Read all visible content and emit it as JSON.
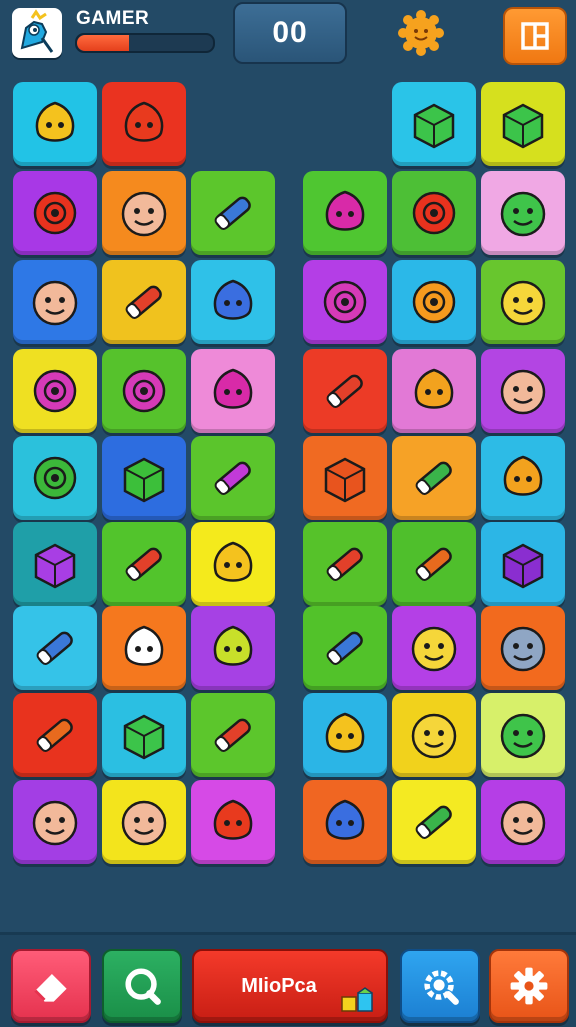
{
  "header": {
    "player_name": "GAMER",
    "health_percent": 38,
    "score": "00"
  },
  "footer": {
    "center_button_label": "MIioPca"
  },
  "board": {
    "tiles": [
      {
        "color": "#22c3e6",
        "icon": "shield-icon"
      },
      {
        "color": "#ea3320",
        "icon": "fire-creature-icon"
      },
      {
        "color": "#2ac4e8",
        "icon": "trash-can-icon"
      },
      {
        "color": "#d6e01e",
        "icon": "robot-icon"
      },
      {
        "color": "#a838e6",
        "icon": "gear-badge-icon"
      },
      {
        "color": "#f58a1e",
        "icon": "clown-icon"
      },
      {
        "color": "#5cc62c",
        "icon": "marker-icon"
      },
      {
        "color": "#4fc631",
        "icon": "berry-icon"
      },
      {
        "color": "#4dbf36",
        "icon": "no-sign-icon"
      },
      {
        "color": "#f0a8e4",
        "icon": "alien-blob-icon"
      },
      {
        "color": "#2e78e6",
        "icon": "blob-face-icon"
      },
      {
        "color": "#f0c21e",
        "icon": "crayon-icon"
      },
      {
        "color": "#2fc1e8",
        "icon": "cell-icon"
      },
      {
        "color": "#b43ee6",
        "icon": "ring-icon"
      },
      {
        "color": "#2bb8e8",
        "icon": "sun-icon"
      },
      {
        "color": "#68c62e",
        "icon": "smiley-icon"
      },
      {
        "color": "#efe022",
        "icon": "spiral-icon"
      },
      {
        "color": "#56c22c",
        "icon": "bubbles-icon"
      },
      {
        "color": "#ee8ad8",
        "icon": "badge-icon"
      },
      {
        "color": "#ec3b26",
        "icon": "torch-icon"
      },
      {
        "color": "#e279d6",
        "icon": "leaf-icon"
      },
      {
        "color": "#b345e3",
        "icon": "girl-face-icon"
      },
      {
        "color": "#2bc1dc",
        "icon": "virus-icon"
      },
      {
        "color": "#2d6de0",
        "icon": "tent-icon"
      },
      {
        "color": "#5bc52c",
        "icon": "eraser-icon"
      },
      {
        "color": "#f06a22",
        "icon": "bag-icon"
      },
      {
        "color": "#f6a226",
        "icon": "glue-stick-icon"
      },
      {
        "color": "#2dbbe6",
        "icon": "dragon-icon"
      },
      {
        "color": "#1f9fa8",
        "icon": "gem-block-icon"
      },
      {
        "color": "#52c42c",
        "icon": "pill-icon"
      },
      {
        "color": "#f4ea1c",
        "icon": "egg-icon"
      },
      {
        "color": "#56c22a",
        "icon": "capsule-icon"
      },
      {
        "color": "#4fbf2c",
        "icon": "wrench-icon"
      },
      {
        "color": "#2cb6e6",
        "icon": "canister-icon"
      },
      {
        "color": "#35c3e8",
        "icon": "pen-icon"
      },
      {
        "color": "#f5781e",
        "icon": "ghost-icon"
      },
      {
        "color": "#a641e4",
        "icon": "rocket-icon"
      },
      {
        "color": "#52c22a",
        "icon": "battery-icon"
      },
      {
        "color": "#b440e6",
        "icon": "cookie-icon"
      },
      {
        "color": "#f26a1e",
        "icon": "moon-icon"
      },
      {
        "color": "#e8331e",
        "icon": "feather-icon"
      },
      {
        "color": "#2bbfe2",
        "icon": "cube-icon"
      },
      {
        "color": "#5cc62c",
        "icon": "chalk-icon"
      },
      {
        "color": "#2bb5e6",
        "icon": "egg-red-icon"
      },
      {
        "color": "#f1d21c",
        "icon": "clock-face-icon"
      },
      {
        "color": "#d7f06a",
        "icon": "alien-icon"
      },
      {
        "color": "#a33ee4",
        "icon": "mummy-icon"
      },
      {
        "color": "#f3e41c",
        "icon": "old-man-icon"
      },
      {
        "color": "#d64ae6",
        "icon": "flame-drop-icon"
      },
      {
        "color": "#f06622",
        "icon": "globe-icon"
      },
      {
        "color": "#f4ea22",
        "icon": "band-aid-icon"
      },
      {
        "color": "#b53ee6",
        "icon": "cat-girl-icon"
      }
    ]
  }
}
